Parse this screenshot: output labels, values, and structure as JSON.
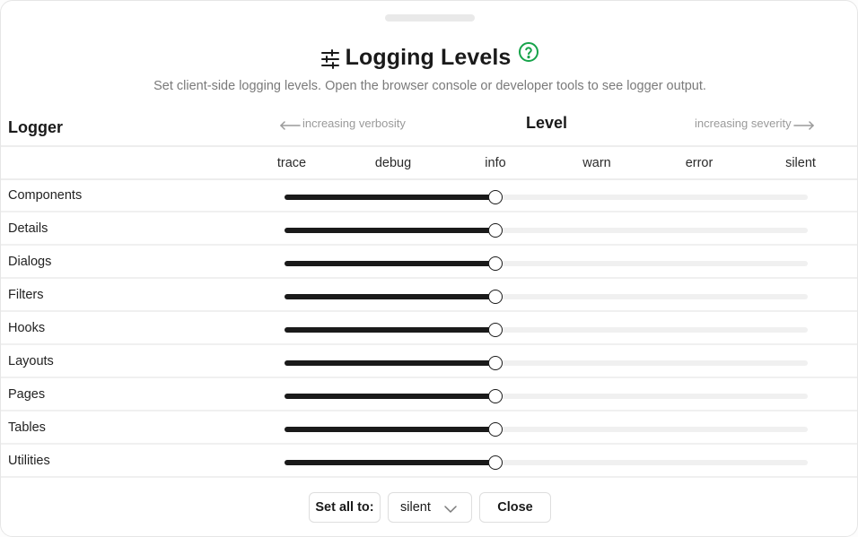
{
  "dialog": {
    "title": "Logging Levels",
    "subtitle": "Set client-side logging levels. Open the browser console or developer tools to see logger output.",
    "title_icon": "sliders-icon",
    "help_icon": "help-circle-icon",
    "help_icon_color": "#16a34a"
  },
  "table": {
    "logger_header": "Logger",
    "level_header": "Level",
    "verbosity_hint": "increasing verbosity",
    "severity_hint": "increasing severity",
    "levels": [
      "trace",
      "debug",
      "info",
      "warn",
      "error",
      "silent"
    ],
    "loggers": [
      {
        "name": "Components",
        "level": "info",
        "level_index": 2
      },
      {
        "name": "Details",
        "level": "info",
        "level_index": 2
      },
      {
        "name": "Dialogs",
        "level": "info",
        "level_index": 2
      },
      {
        "name": "Filters",
        "level": "info",
        "level_index": 2
      },
      {
        "name": "Hooks",
        "level": "info",
        "level_index": 2
      },
      {
        "name": "Layouts",
        "level": "info",
        "level_index": 2
      },
      {
        "name": "Pages",
        "level": "info",
        "level_index": 2
      },
      {
        "name": "Tables",
        "level": "info",
        "level_index": 2
      },
      {
        "name": "Utilities",
        "level": "info",
        "level_index": 2
      }
    ]
  },
  "footer": {
    "set_all_label": "Set all to:",
    "set_all_value": "silent",
    "close_label": "Close"
  },
  "colors": {
    "slider_fill": "#1a1a1a",
    "slider_track": "#f0f0f0",
    "accent_help": "#16a34a"
  }
}
